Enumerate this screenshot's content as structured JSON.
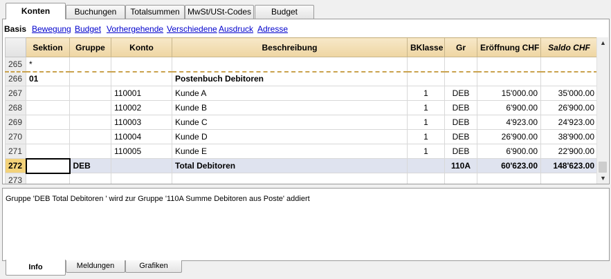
{
  "top_tabs": [
    "Konten",
    "Buchungen",
    "Totalsummen",
    "MwSt/USt-Codes",
    "Budget"
  ],
  "view_bar": {
    "current": "Basis",
    "links": [
      "Bewegung",
      "Budget",
      "Vorhergehende",
      "Verschiedene",
      "Ausdruck",
      "Adresse"
    ]
  },
  "table": {
    "columns": [
      "Sektion",
      "Gruppe",
      "Konto",
      "Beschreibung",
      "BKlasse",
      "Gr",
      "Eröffnung CHF",
      "Saldo CHF"
    ],
    "rows": [
      {
        "num": "265",
        "sektion": "*",
        "gruppe": "",
        "konto": "",
        "beschreibung": "",
        "bklasse": "",
        "gr": "",
        "eroeffnung": "",
        "saldo": ""
      },
      {
        "num": "266",
        "sektion": "01",
        "gruppe": "",
        "konto": "",
        "beschreibung": "Postenbuch Debitoren",
        "bklasse": "",
        "gr": "",
        "eroeffnung": "",
        "saldo": ""
      },
      {
        "num": "267",
        "sektion": "",
        "gruppe": "",
        "konto": "110001",
        "beschreibung": "Kunde A",
        "bklasse": "1",
        "gr": "DEB",
        "eroeffnung": "15'000.00",
        "saldo": "35'000.00"
      },
      {
        "num": "268",
        "sektion": "",
        "gruppe": "",
        "konto": "110002",
        "beschreibung": "Kunde B",
        "bklasse": "1",
        "gr": "DEB",
        "eroeffnung": "6'900.00",
        "saldo": "26'900.00"
      },
      {
        "num": "269",
        "sektion": "",
        "gruppe": "",
        "konto": "110003",
        "beschreibung": "Kunde C",
        "bklasse": "1",
        "gr": "DEB",
        "eroeffnung": "4'923.00",
        "saldo": "24'923.00"
      },
      {
        "num": "270",
        "sektion": "",
        "gruppe": "",
        "konto": "110004",
        "beschreibung": "Kunde D",
        "bklasse": "1",
        "gr": "DEB",
        "eroeffnung": "26'900.00",
        "saldo": "38'900.00"
      },
      {
        "num": "271",
        "sektion": "",
        "gruppe": "",
        "konto": "110005",
        "beschreibung": "Kunde E",
        "bklasse": "1",
        "gr": "DEB",
        "eroeffnung": "6'900.00",
        "saldo": "22'900.00"
      },
      {
        "num": "272",
        "sektion": "",
        "gruppe": "DEB",
        "konto": "",
        "beschreibung": "Total Debitoren",
        "bklasse": "",
        "gr": "110A",
        "eroeffnung": "60'623.00",
        "saldo": "148'623.00"
      },
      {
        "num": "273",
        "sektion": "",
        "gruppe": "",
        "konto": "",
        "beschreibung": "",
        "bklasse": "",
        "gr": "",
        "eroeffnung": "",
        "saldo": ""
      }
    ]
  },
  "info_message": "Gruppe 'DEB Total Debitoren ' wird zur Gruppe '110A Summe Debitoren aus Poste' addiert",
  "bottom_tabs": [
    "Info",
    "Meldungen",
    "Grafiken"
  ]
}
